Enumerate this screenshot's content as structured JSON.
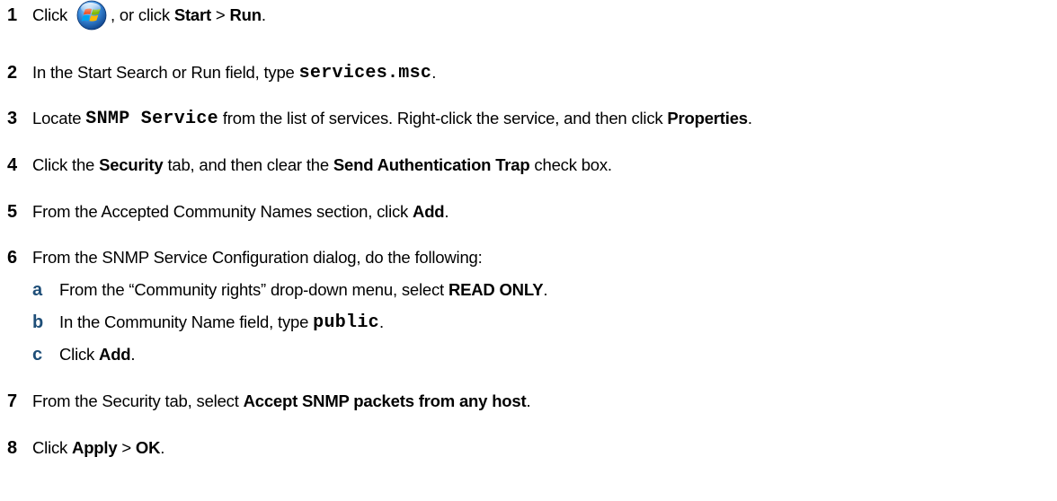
{
  "steps": [
    {
      "num": "1",
      "text_a": "Click ",
      "icon": "windows-start-orb-icon",
      "text_b": ", or click ",
      "bold_a": "Start",
      "text_c": " > ",
      "bold_b": "Run",
      "text_d": "."
    },
    {
      "num": "2",
      "text_a": "In the Start Search or Run field, type ",
      "code_a": "services.msc",
      "text_b": "."
    },
    {
      "num": "3",
      "text_a": "Locate ",
      "code_a": "SNMP Service",
      "text_b": " from the list of services. Right-click the service, and then click ",
      "bold_a": "Properties",
      "text_c": "."
    },
    {
      "num": "4",
      "text_a": "Click the ",
      "bold_a": "Security",
      "text_b": " tab, and then clear the ",
      "bold_b": "Send Authentication Trap",
      "text_c": " check box."
    },
    {
      "num": "5",
      "text_a": "From the Accepted Community Names section, click ",
      "bold_a": "Add",
      "text_b": "."
    },
    {
      "num": "6",
      "text_a": "From the SNMP Service Configuration dialog, do the following:",
      "substeps": [
        {
          "num": "a",
          "text_a": "From the “Community rights” drop-down menu, select ",
          "bold_a": "READ ONLY",
          "text_b": "."
        },
        {
          "num": "b",
          "text_a": "In the Community Name field, type ",
          "code_a": "public",
          "text_b": "."
        },
        {
          "num": "c",
          "text_a": "Click ",
          "bold_a": "Add",
          "text_b": "."
        }
      ]
    },
    {
      "num": "7",
      "text_a": "From the Security tab, select ",
      "bold_a": "Accept SNMP packets from any host",
      "text_b": "."
    },
    {
      "num": "8",
      "text_a": "Click ",
      "bold_a": "Apply",
      "text_b": " > ",
      "bold_b": "OK",
      "text_c": "."
    }
  ]
}
